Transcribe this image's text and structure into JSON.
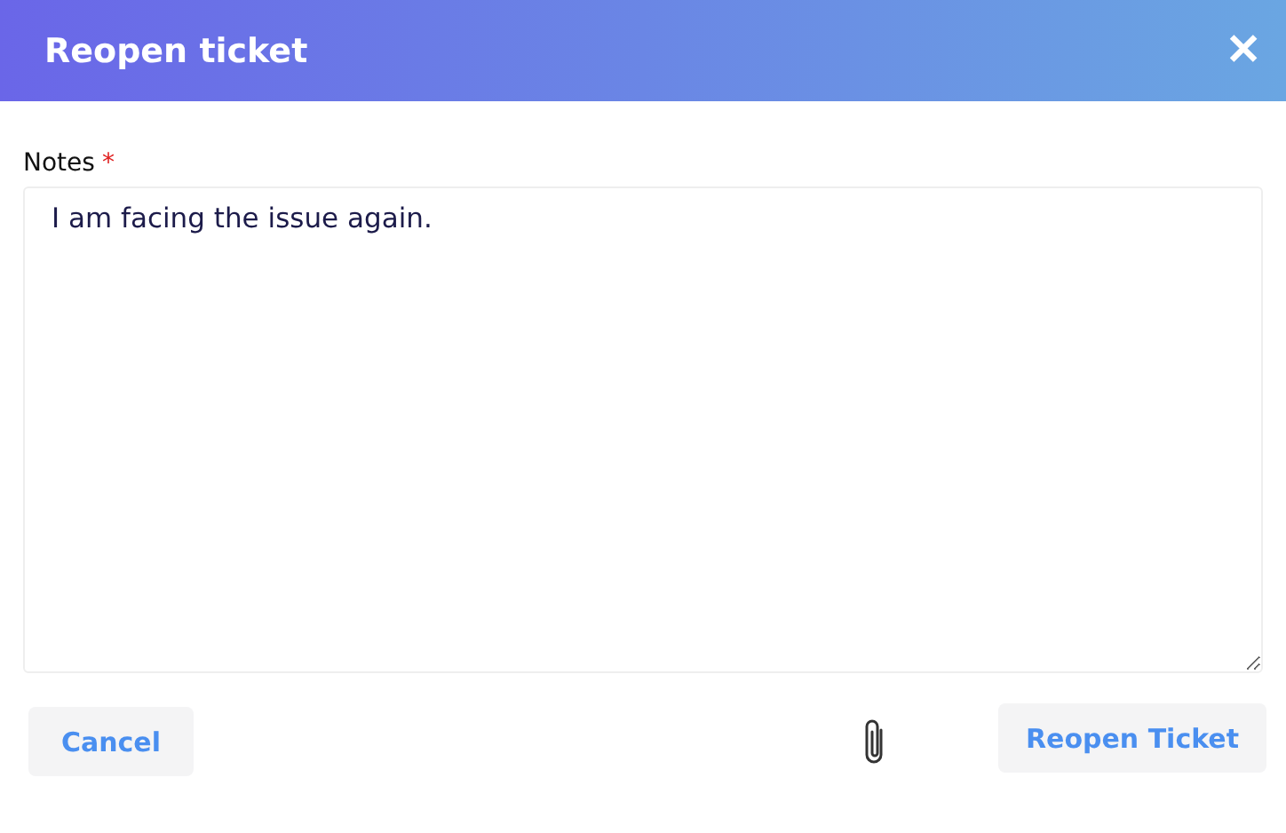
{
  "dialog": {
    "title": "Reopen ticket",
    "close": "✕"
  },
  "notes": {
    "label": "Notes",
    "required": true,
    "required_mark": "*",
    "value": "I am facing the issue again."
  },
  "buttons": [
    {
      "kind": "cancel",
      "label": "Cancel"
    },
    {
      "kind": "attach"
    },
    {
      "kind": "submit",
      "label": "Reopen Ticket"
    }
  ]
}
